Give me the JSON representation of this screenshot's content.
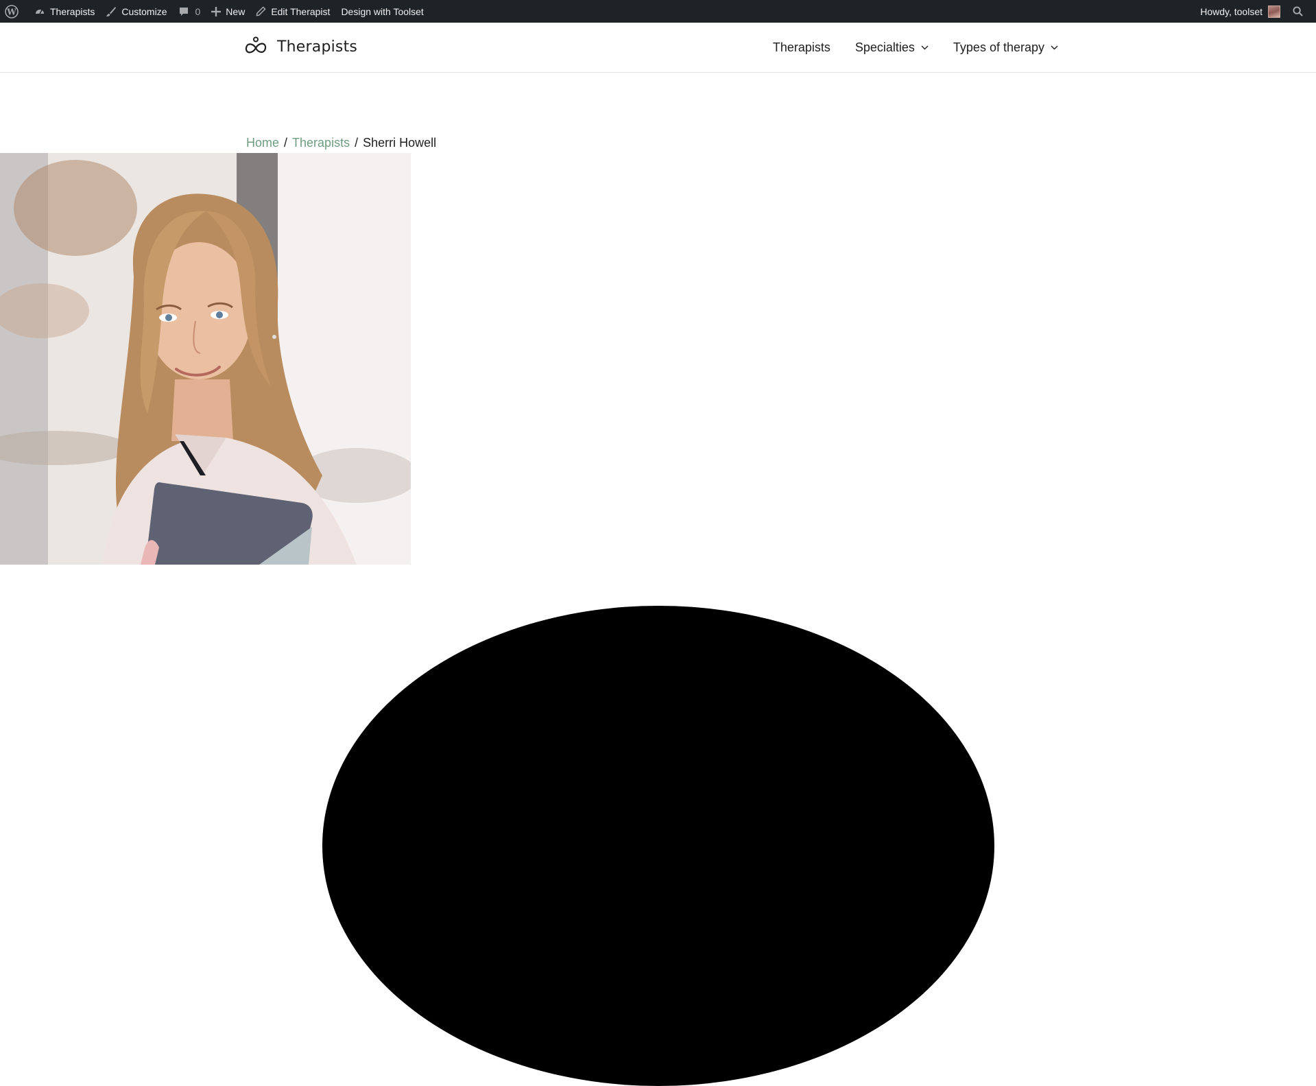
{
  "admin_bar": {
    "site_name": "Therapists",
    "customize": "Customize",
    "comments_count": "0",
    "new": "New",
    "edit_item": "Edit Therapist",
    "design_with": "Design with Toolset",
    "howdy": "Howdy, toolset"
  },
  "header": {
    "brand_name": "Therapists",
    "nav": [
      {
        "label": "Therapists"
      },
      {
        "label": "Specialties"
      },
      {
        "label": "Types of therapy"
      }
    ]
  },
  "breadcrumb": {
    "home": "Home",
    "section": "Therapists",
    "current": "Sherri Howell",
    "separator": "/"
  },
  "colors": {
    "admin_bar_bg": "#1d2327",
    "link_accent": "#6e9c80",
    "text": "#1e1e1e"
  }
}
